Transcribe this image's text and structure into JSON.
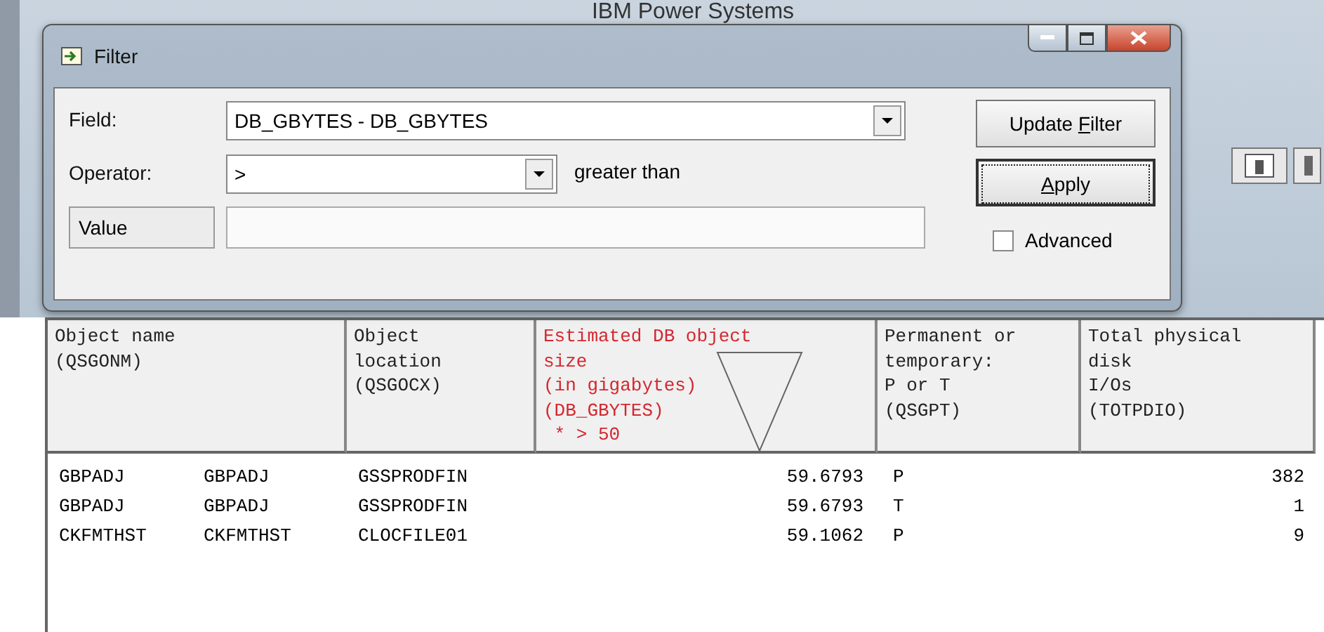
{
  "app": {
    "title": "IBM Power Systems"
  },
  "dialog": {
    "title": "Filter",
    "field": {
      "label": "Field:",
      "value": "DB_GBYTES - DB_GBYTES"
    },
    "operator": {
      "label": "Operator:",
      "value": ">",
      "description": "greater than"
    },
    "value": {
      "label": "Value"
    },
    "buttons": [
      {
        "label_before": "Update ",
        "mnemonic": "F",
        "label_after": "ilter",
        "focused": false
      },
      {
        "mnemonic": "A",
        "label_after": "pply",
        "focused": true
      }
    ],
    "advanced": {
      "label": "Advanced",
      "checked": false
    }
  },
  "table": {
    "columns": [
      {
        "lines": [
          "Object name",
          "(QSGONM)"
        ],
        "filtered": false
      },
      {
        "lines": [
          "Object",
          "location",
          "(QSGOCX)"
        ],
        "filtered": false
      },
      {
        "lines": [
          "Estimated DB object",
          "size",
          "(in gigabytes)",
          "(DB_GBYTES)",
          " * > 50"
        ],
        "filtered": true,
        "sorted": true
      },
      {
        "lines": [
          "Permanent or",
          "temporary:",
          "P or T",
          "(QSGPT)"
        ],
        "filtered": false
      },
      {
        "lines": [
          "Total physical",
          "disk",
          "I/Os",
          "(TOTPDIO)"
        ],
        "filtered": false
      }
    ],
    "rows": [
      {
        "cells": [
          [
            "GBPADJ",
            "GBPADJ"
          ],
          "GSSPRODFIN",
          "59.6793",
          "P",
          "382"
        ]
      },
      {
        "cells": [
          [
            "GBPADJ",
            "GBPADJ"
          ],
          "GSSPRODFIN",
          "59.6793",
          "T",
          "1"
        ]
      },
      {
        "cells": [
          [
            "CKFMTHST",
            "CKFMTHST"
          ],
          "CLOCFILE01",
          "59.1062",
          "P",
          "9"
        ]
      }
    ]
  }
}
